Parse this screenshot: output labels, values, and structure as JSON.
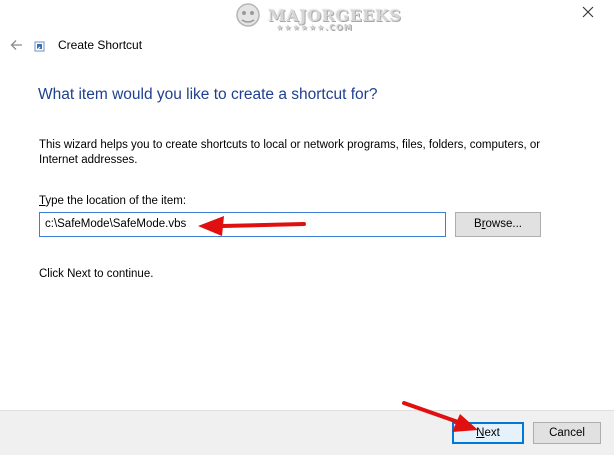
{
  "window": {
    "title": "Create Shortcut",
    "icons": {
      "back": "back-arrow-icon",
      "app": "shortcut-icon",
      "close": "close-icon"
    }
  },
  "watermark": {
    "text": "MAJORGEEKS",
    "sub": "★★★★★★.COM"
  },
  "page": {
    "heading": "What item would you like to create a shortcut for?",
    "description": "This wizard helps you to create shortcuts to local or network programs, files, folders, computers, or Internet addresses.",
    "location_label_first": "T",
    "location_label_rest": "ype the location of the item:",
    "location_value": "c:\\SafeMode\\SafeMode.vbs",
    "browse_mnemonic": "r",
    "browse_before": "B",
    "browse_after": "owse...",
    "continue_text": "Click Next to continue."
  },
  "footer": {
    "next_mnemonic": "N",
    "next_rest": "ext",
    "cancel_label": "Cancel"
  },
  "annotations": {
    "arrow_color": "#e01010"
  }
}
